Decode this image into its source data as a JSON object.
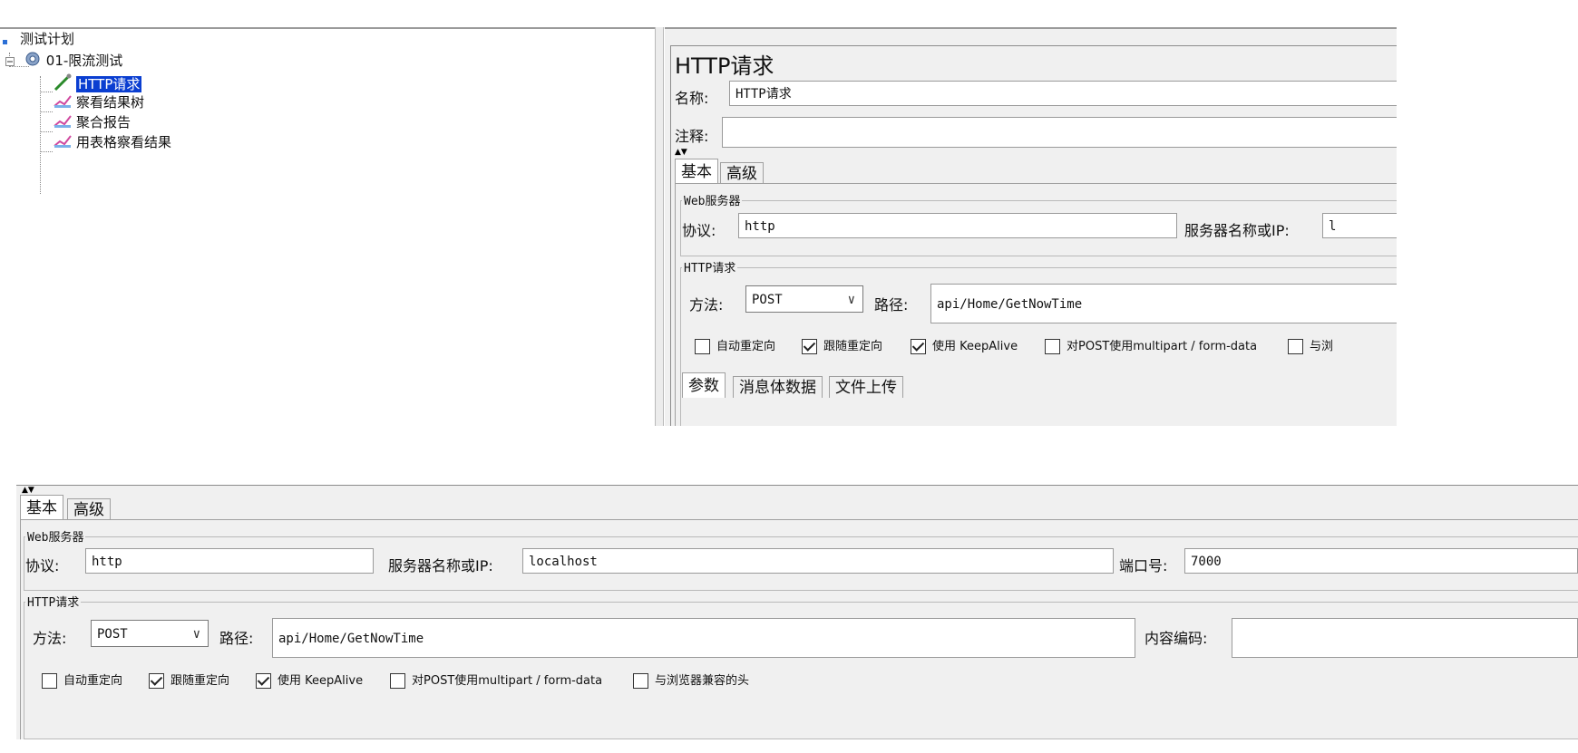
{
  "tree": {
    "root_label": "测试计划",
    "group_label": "01-限流测试",
    "items": [
      {
        "label": "HTTP请求",
        "selected": true
      },
      {
        "label": "察看结果树",
        "selected": false
      },
      {
        "label": "聚合报告",
        "selected": false
      },
      {
        "label": "用表格察看结果",
        "selected": false
      }
    ]
  },
  "sampler": {
    "title": "HTTP请求",
    "name_label": "名称:",
    "name_value": "HTTP请求",
    "comment_label": "注释:",
    "comment_value": ""
  },
  "tabs": {
    "basic": "基本",
    "advanced": "高级"
  },
  "web_server": {
    "group_title": "Web服务器",
    "protocol_label": "协议:",
    "protocol_value": "http",
    "server_label": "服务器名称或IP:",
    "server_value": "localhost",
    "server_value_truncated": "l",
    "port_label": "端口号:",
    "port_value": "7000"
  },
  "http_request": {
    "group_title": "HTTP请求",
    "method_label": "方法:",
    "method_value": "POST",
    "path_label": "路径:",
    "path_value": "api/Home/GetNowTime",
    "encoding_label": "内容编码:",
    "encoding_value": ""
  },
  "options": [
    {
      "label": "自动重定向",
      "checked": false
    },
    {
      "label": "跟随重定向",
      "checked": true
    },
    {
      "label": "使用 KeepAlive",
      "checked": true
    },
    {
      "label": "对POST使用multipart / form-data",
      "checked": false
    },
    {
      "label": "与浏览器兼容的头",
      "checked": false
    }
  ],
  "option_last_truncated": "与浏",
  "body_tabs": [
    "参数",
    "消息体数据",
    "文件上传"
  ]
}
